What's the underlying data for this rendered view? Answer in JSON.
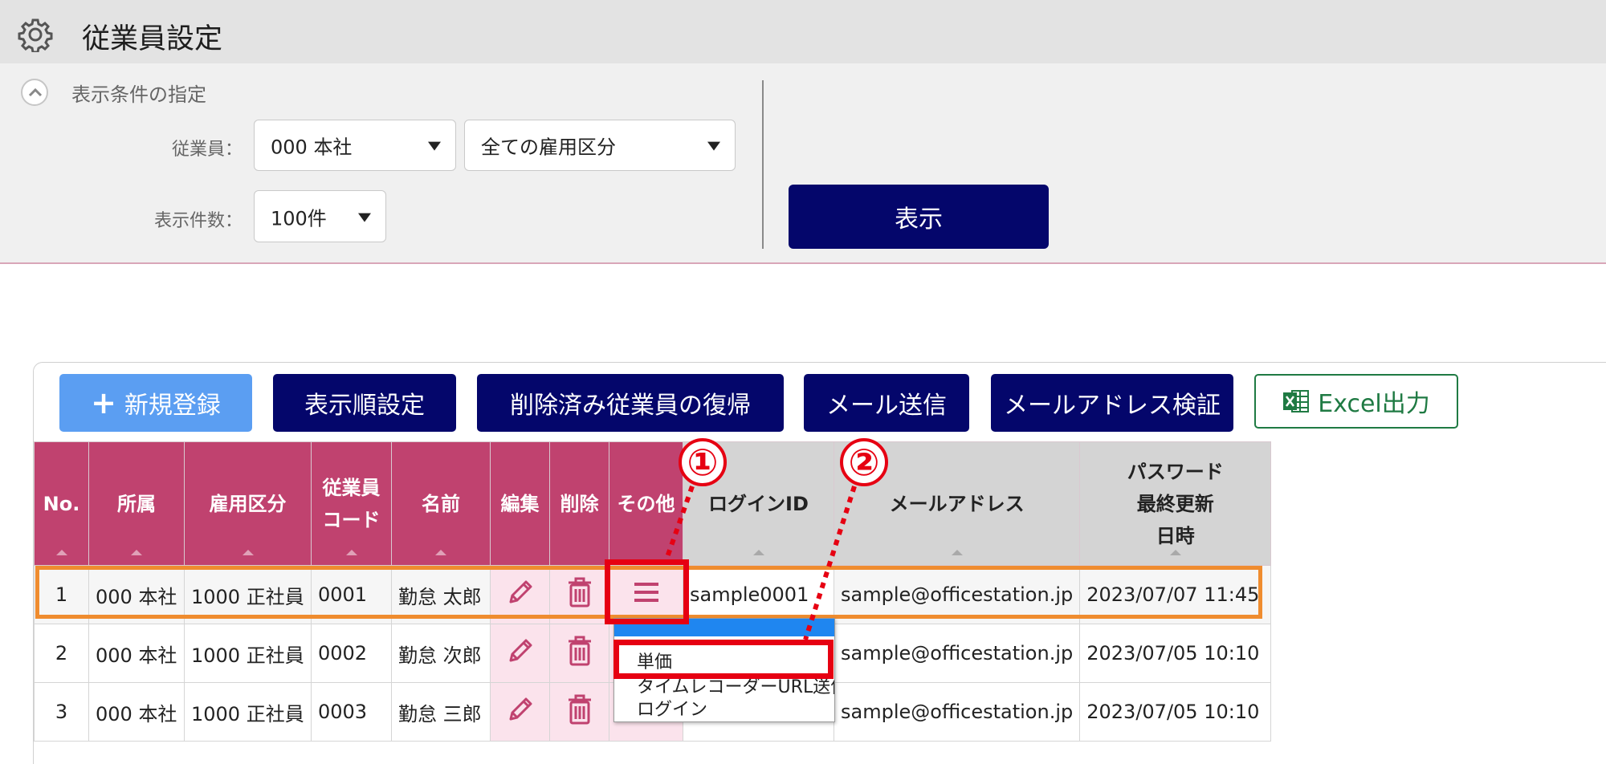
{
  "header": {
    "title": "従業員設定",
    "icon": "gear-icon"
  },
  "filter": {
    "heading": "表示条件の指定",
    "employee_label": "従業員：",
    "employee_value": "000 本社",
    "employment_type_value": "全ての雇用区分",
    "count_label": "表示件数：",
    "count_value": "100件",
    "show_button": "表示"
  },
  "toolbar": {
    "new": "新規登録",
    "order": "表示順設定",
    "restore": "削除済み従業員の復帰",
    "mail": "メール送信",
    "verify": "メールアドレス検証",
    "excel": "Excel出力"
  },
  "table": {
    "headers": {
      "no": "No.",
      "dept": "所属",
      "type": "雇用区分",
      "code_1": "従業員",
      "code_2": "コード",
      "name": "名前",
      "edit": "編集",
      "delete": "削除",
      "other": "その他",
      "login": "ログインID",
      "email": "メールアドレス",
      "pw_1": "パスワード",
      "pw_2": "最終更新",
      "pw_3": "日時"
    },
    "rows": [
      {
        "no": "1",
        "dept": "000 本社",
        "type": "1000 正社員",
        "code": "0001",
        "name": "勤怠 太郎",
        "login": "sample0001",
        "email": "sample@officestation.jp",
        "updated": "2023/07/07 11:45"
      },
      {
        "no": "2",
        "dept": "000 本社",
        "type": "1000 正社員",
        "code": "0002",
        "name": "勤怠 次郎",
        "login": "",
        "email": "sample@officestation.jp",
        "updated": "2023/07/05 10:10"
      },
      {
        "no": "3",
        "dept": "000 本社",
        "type": "1000 正社員",
        "code": "0003",
        "name": "勤怠 三郎",
        "login": "",
        "email": "sample@officestation.jp",
        "updated": "2023/07/05 10:10"
      }
    ]
  },
  "menu": {
    "items": [
      "単価",
      "タイムレコーダーURL送信",
      "ログイン"
    ]
  },
  "annotations": {
    "one": "①",
    "two": "②"
  },
  "colors": {
    "header_pink": "#c0426f",
    "navy": "#04066b",
    "new_blue": "#5b9ef2",
    "annotation_red": "#e60012",
    "row_orange": "#ef8c2f"
  }
}
